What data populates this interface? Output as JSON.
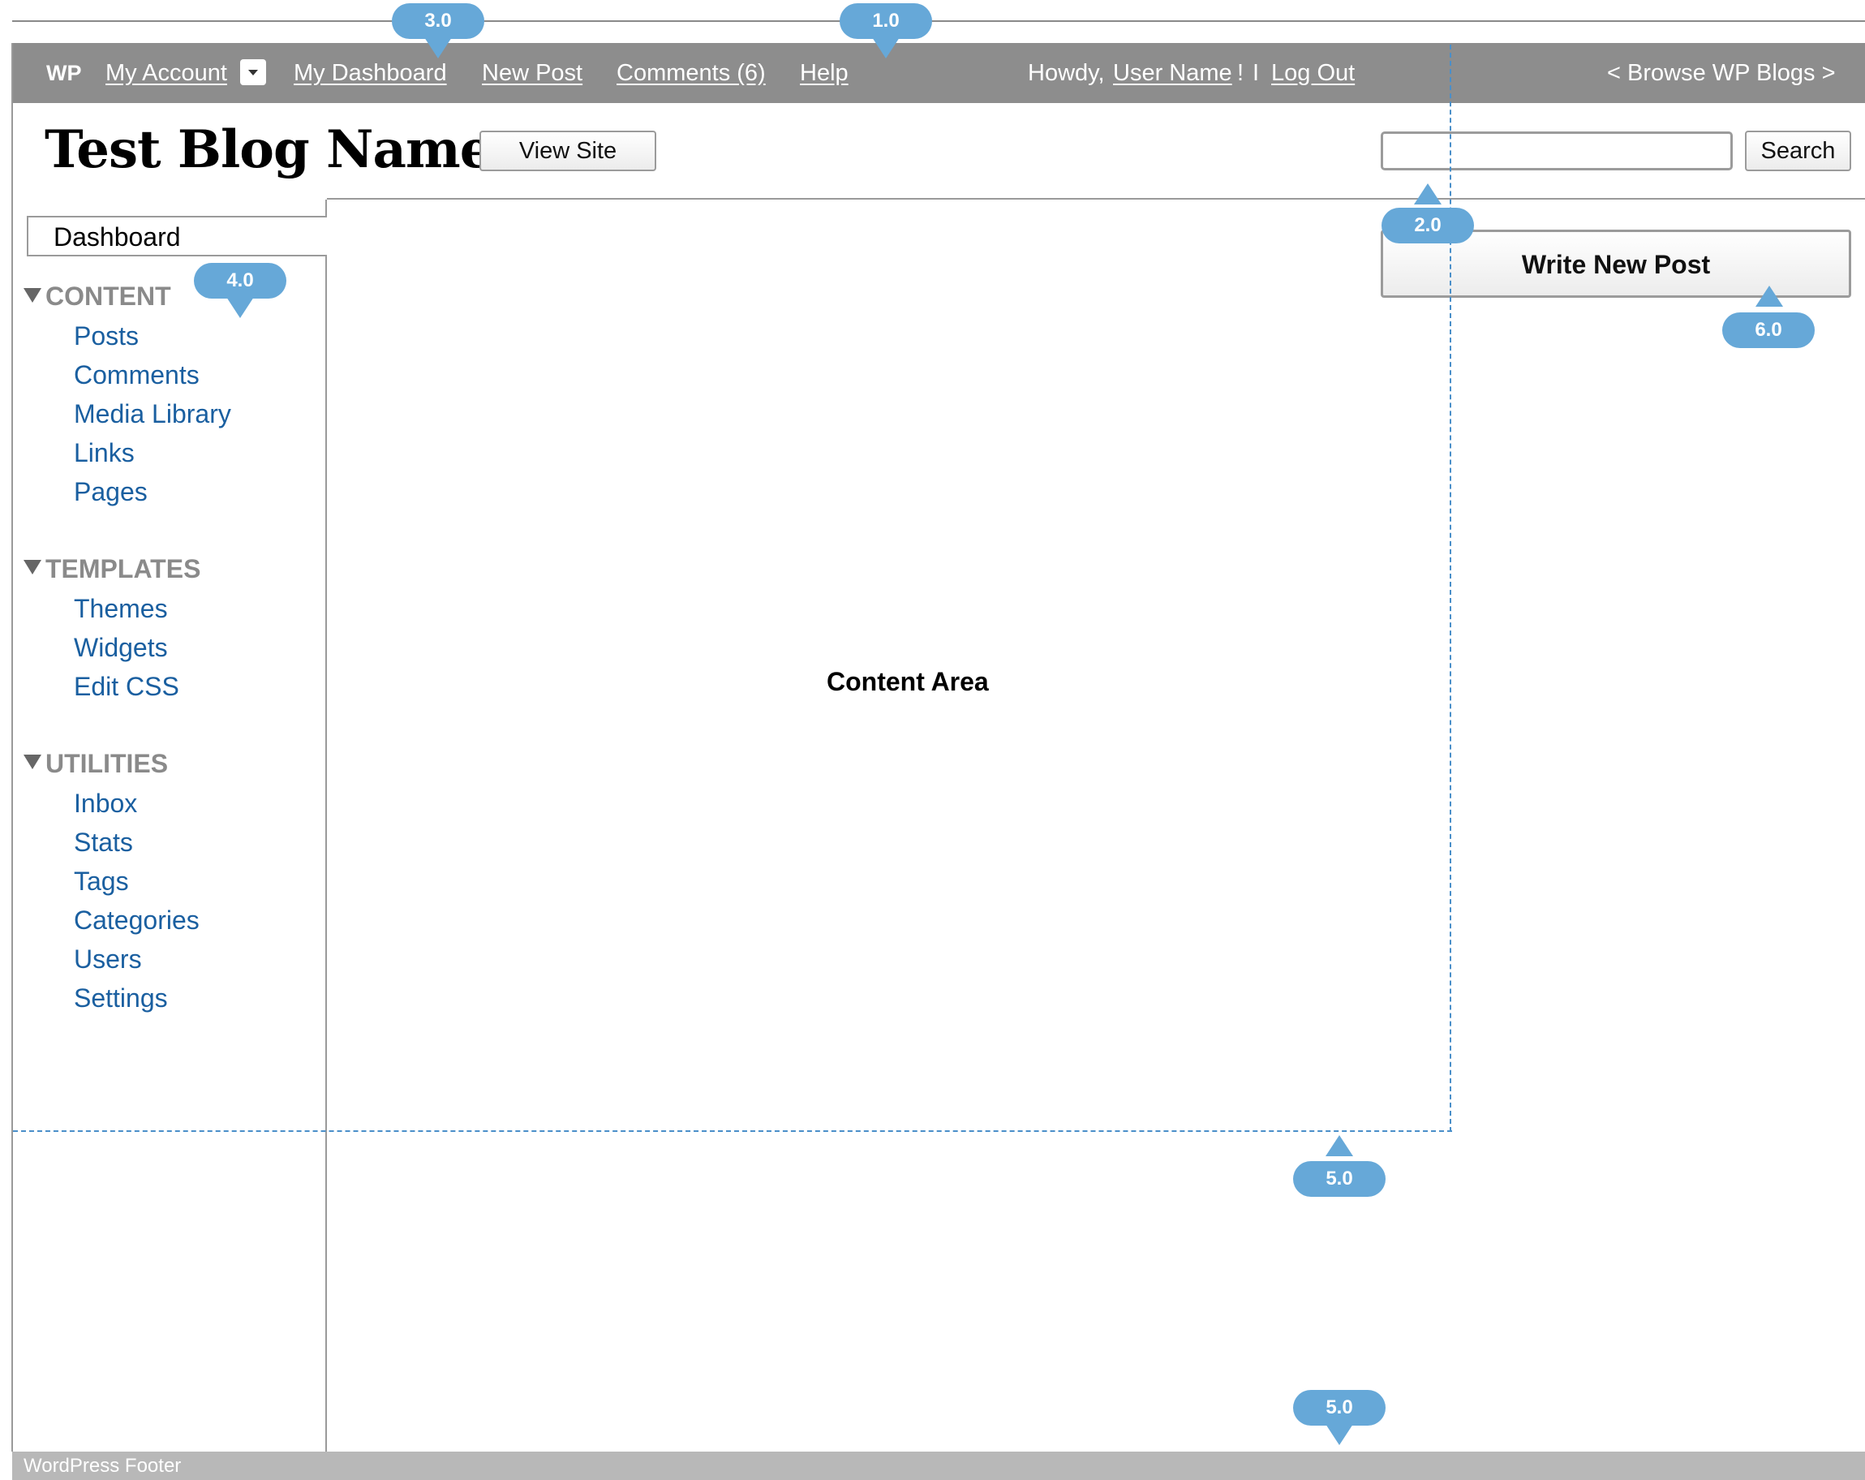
{
  "admin_bar": {
    "logo": "WP",
    "my_account": "My Account",
    "my_dashboard": "My Dashboard",
    "new_post": "New Post",
    "comments": "Comments (6)",
    "help": "Help",
    "howdy_prefix": "Howdy,",
    "user_name": "User Name",
    "howdy_suffix": "!",
    "separator": "I",
    "log_out": "Log Out",
    "browse": "< Browse WP Blogs >"
  },
  "header": {
    "blog_title": "Test Blog Name",
    "view_site": "View Site",
    "search_value": "",
    "search_button": "Search"
  },
  "sidebar": {
    "dashboard": "Dashboard",
    "sections": [
      {
        "title": "CONTENT",
        "items": [
          "Posts",
          "Comments",
          "Media Library",
          "Links",
          "Pages"
        ]
      },
      {
        "title": "TEMPLATES",
        "items": [
          "Themes",
          "Widgets",
          "Edit CSS"
        ]
      },
      {
        "title": "UTILITIES",
        "items": [
          "Inbox",
          "Stats",
          "Tags",
          "Categories",
          "Users",
          "Settings"
        ]
      }
    ]
  },
  "main": {
    "content_label": "Content Area",
    "write_new_post": "Write New Post"
  },
  "footer": {
    "text": "WordPress Footer"
  },
  "callouts": {
    "c1": "1.0",
    "c2": "2.0",
    "c3": "3.0",
    "c4": "4.0",
    "c5a": "5.0",
    "c5b": "5.0",
    "c6": "6.0"
  },
  "colors": {
    "admin_bar": "#8d8d8d",
    "link_blue": "#1a5fa0",
    "callout_blue": "#66a8d8",
    "footer": "#b8b8b8"
  }
}
